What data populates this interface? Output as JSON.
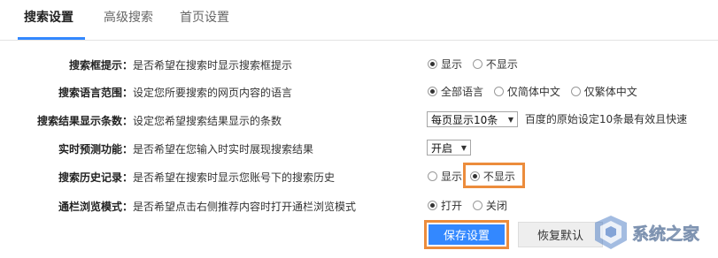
{
  "tabs": [
    {
      "label": "搜索设置",
      "active": true
    },
    {
      "label": "高级搜索",
      "active": false
    },
    {
      "label": "首页设置",
      "active": false
    }
  ],
  "settings": {
    "search_box_hint": {
      "label": "搜索框提示：",
      "description": "是否希望在搜索时显示搜索框提示",
      "options": [
        {
          "text": "显示",
          "checked": true
        },
        {
          "text": "不显示",
          "checked": false
        }
      ]
    },
    "search_language": {
      "label": "搜索语言范围：",
      "description": "设定您所要搜索的网页内容的语言",
      "options": [
        {
          "text": "全部语言",
          "checked": true
        },
        {
          "text": "仅简体中文",
          "checked": false
        },
        {
          "text": "仅繁体中文",
          "checked": false
        }
      ]
    },
    "results_count": {
      "label": "搜索结果显示条数：",
      "description": "设定您希望搜索结果显示的条数",
      "select_value": "每页显示10条",
      "note": "百度的原始设定10条最有效且快速"
    },
    "realtime_prediction": {
      "label": "实时预测功能：",
      "description": "是否希望在您输入时实时展现搜索结果",
      "select_value": "开启"
    },
    "search_history": {
      "label": "搜索历史记录：",
      "description": "是否希望在搜索时显示您账号下的搜索历史",
      "options": [
        {
          "text": "显示",
          "checked": false
        },
        {
          "text": "不显示",
          "checked": true
        }
      ]
    },
    "browse_mode": {
      "label": "通栏浏览模式：",
      "description": "是否希望点击右侧推荐内容时打开通栏浏览模式",
      "options": [
        {
          "text": "打开",
          "checked": true
        },
        {
          "text": "关闭",
          "checked": false
        }
      ]
    }
  },
  "buttons": {
    "save": "保存设置",
    "restore": "恢复默认"
  },
  "watermark": {
    "text": "系统之家"
  },
  "colors": {
    "accent": "#3388ff",
    "highlight": "#ec8c3c"
  }
}
